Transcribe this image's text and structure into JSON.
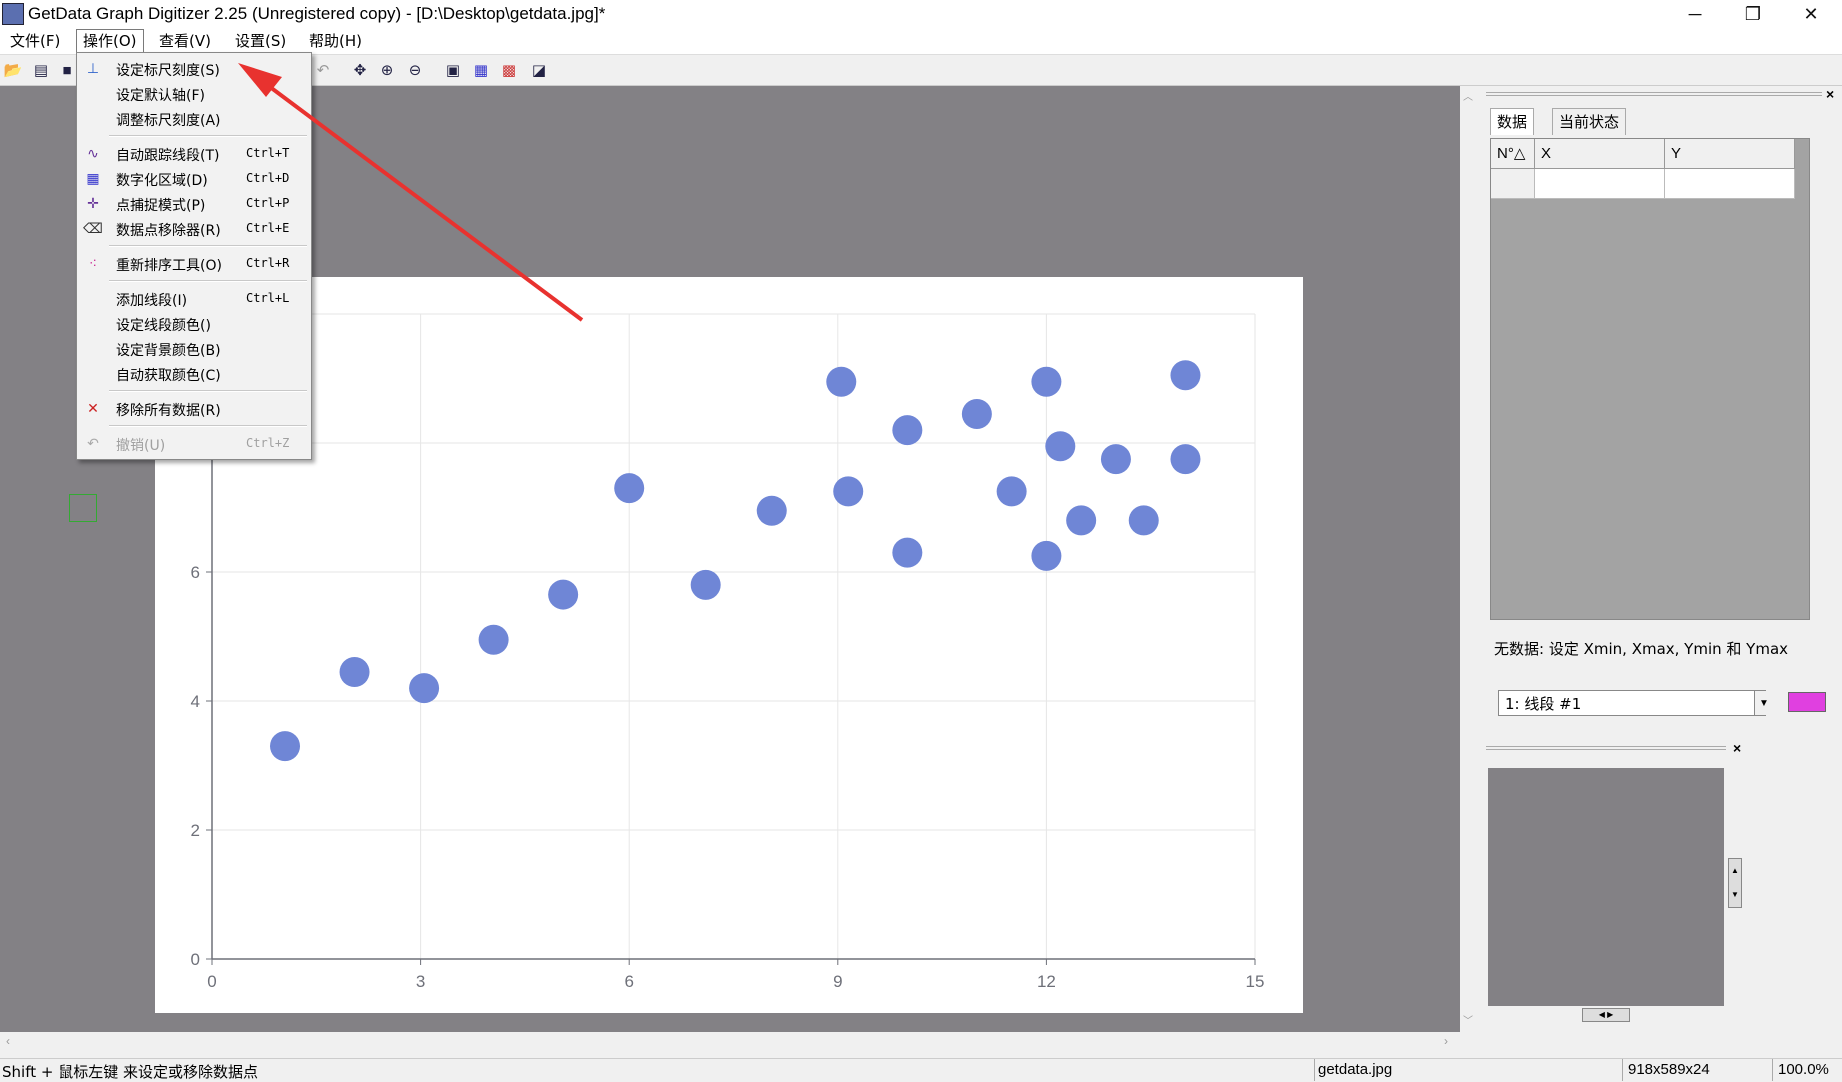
{
  "window": {
    "title": "GetData Graph Digitizer 2.25 (Unregistered copy) - [D:\\Desktop\\getdata.jpg]*",
    "minimize": "─",
    "restore": "❐",
    "close": "✕"
  },
  "menubar": {
    "items": [
      "文件(F)",
      "操作(O)",
      "查看(V)",
      "设置(S)",
      "帮助(H)"
    ]
  },
  "dropdown": {
    "items": [
      {
        "label": "设定标尺刻度(S)",
        "shortcut": "",
        "icon": "axes-icon"
      },
      {
        "label": "设定默认轴(F)",
        "shortcut": ""
      },
      {
        "label": "调整标尺刻度(A)",
        "shortcut": ""
      },
      {
        "label": "自动跟踪线段(T)",
        "shortcut": "Ctrl+T",
        "icon": "trace-icon"
      },
      {
        "label": "数字化区域(D)",
        "shortcut": "Ctrl+D",
        "icon": "grid-icon"
      },
      {
        "label": "点捕捉模式(P)",
        "shortcut": "Ctrl+P",
        "icon": "point-capture-icon"
      },
      {
        "label": "数据点移除器(R)",
        "shortcut": "Ctrl+E",
        "icon": "eraser-icon"
      },
      {
        "label": "重新排序工具(O)",
        "shortcut": "Ctrl+R",
        "icon": "reorder-icon"
      },
      {
        "label": "添加线段(I)",
        "shortcut": "Ctrl+L"
      },
      {
        "label": "设定线段颜色()",
        "shortcut": ""
      },
      {
        "label": "设定背景颜色(B)",
        "shortcut": ""
      },
      {
        "label": "自动获取颜色(C)",
        "shortcut": ""
      },
      {
        "label": "移除所有数据(R)",
        "shortcut": "",
        "icon": "remove-all-icon"
      },
      {
        "label": "撤销(U)",
        "shortcut": "Ctrl+Z",
        "icon": "undo-icon"
      }
    ]
  },
  "right_panel": {
    "tabs": [
      "数据",
      "当前状态"
    ],
    "columns": [
      "N°△",
      "X",
      "Y"
    ],
    "status_text": "无数据: 设定 Xmin, Xmax, Ymin 和 Ymax",
    "segment": "1: 线段 #1",
    "segment_color": "#e040e0",
    "close": "×"
  },
  "status": {
    "hint": "Shift + 鼠标左键 来设定或移除数据点",
    "file": "getdata.jpg",
    "size": "918x589x24",
    "zoom": "100.0%"
  },
  "colors": {
    "canvas_bg": "#838185",
    "point": "#6f86d6",
    "arrow": "#e8322f"
  },
  "chart_data": {
    "type": "scatter",
    "xlim": [
      0,
      15
    ],
    "ylim": [
      0,
      10
    ],
    "x_ticks": [
      "0",
      "3",
      "6",
      "9",
      "12",
      "15"
    ],
    "y_ticks": [
      "0",
      "2",
      "4",
      "6"
    ],
    "grid": true,
    "points": [
      [
        1.05,
        3.3
      ],
      [
        2.05,
        4.45
      ],
      [
        3.05,
        4.2
      ],
      [
        4.05,
        4.95
      ],
      [
        5.05,
        5.65
      ],
      [
        6.0,
        7.3
      ],
      [
        7.1,
        5.8
      ],
      [
        8.05,
        6.95
      ],
      [
        9.05,
        8.95
      ],
      [
        9.15,
        7.25
      ],
      [
        10.0,
        8.2
      ],
      [
        10.0,
        6.3
      ],
      [
        11.0,
        8.45
      ],
      [
        11.5,
        7.25
      ],
      [
        12.0,
        8.95
      ],
      [
        12.2,
        7.95
      ],
      [
        12.0,
        6.25
      ],
      [
        12.5,
        6.8
      ],
      [
        13.0,
        7.75
      ],
      [
        13.4,
        6.8
      ],
      [
        14.0,
        9.05
      ],
      [
        14.0,
        7.75
      ]
    ]
  }
}
